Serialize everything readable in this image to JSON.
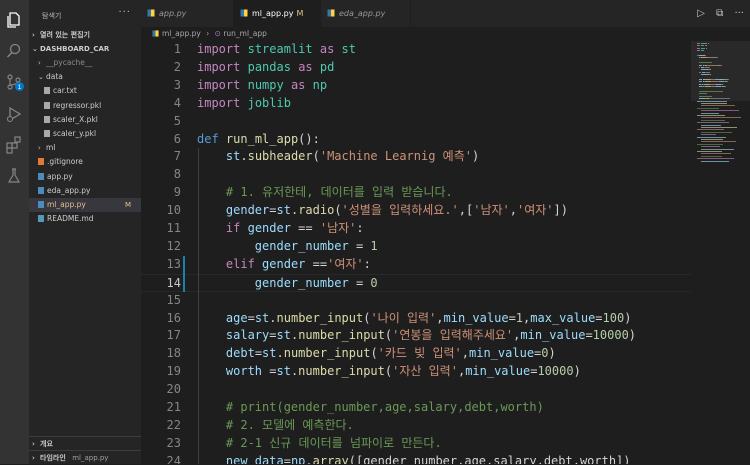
{
  "explorer": {
    "title": "탐색기",
    "more": "···",
    "open_editors": "열려 있는 편집기",
    "project": "DASHBOARD_CAR",
    "tree": [
      {
        "label": "__pycache__",
        "indent": 1,
        "kind": "folder-collapsed",
        "dim": true
      },
      {
        "label": "data",
        "indent": 1,
        "kind": "folder-open"
      },
      {
        "label": "car.txt",
        "indent": 2,
        "kind": "txt"
      },
      {
        "label": "regressor.pkl",
        "indent": 2,
        "kind": "txt"
      },
      {
        "label": "scaler_X.pkl",
        "indent": 2,
        "kind": "txt"
      },
      {
        "label": "scaler_y.pkl",
        "indent": 2,
        "kind": "txt"
      },
      {
        "label": "ml",
        "indent": 1,
        "kind": "folder-collapsed"
      },
      {
        "label": ".gitignore",
        "indent": 1,
        "kind": "git"
      },
      {
        "label": "app.py",
        "indent": 1,
        "kind": "py"
      },
      {
        "label": "eda_app.py",
        "indent": 1,
        "kind": "py"
      },
      {
        "label": "ml_app.py",
        "indent": 1,
        "kind": "py",
        "active": true,
        "badge": "M"
      },
      {
        "label": "README.md",
        "indent": 1,
        "kind": "md"
      }
    ],
    "outline": "개요",
    "timeline": "타임라인",
    "timeline_file": "ml_app.py"
  },
  "tabs": [
    {
      "label": "app.py",
      "active": false
    },
    {
      "label": "ml_app.py",
      "active": true,
      "modified": "M"
    },
    {
      "label": "eda_app.py",
      "active": false
    }
  ],
  "tab_tools": {
    "run": "▷",
    "split": "⧉",
    "more": "···"
  },
  "breadcrumb": {
    "file": "ml_app.py",
    "sep": "›",
    "symbol": "run_ml_app"
  },
  "editor": {
    "current_line": 14,
    "lines": [
      {
        "n": 1,
        "t": [
          [
            "kw",
            "import"
          ],
          [
            "p",
            " "
          ],
          [
            "mod",
            "streamlit"
          ],
          [
            "p",
            " "
          ],
          [
            "kw",
            "as"
          ],
          [
            "p",
            " "
          ],
          [
            "mod",
            "st"
          ]
        ]
      },
      {
        "n": 2,
        "t": [
          [
            "kw",
            "import"
          ],
          [
            "p",
            " "
          ],
          [
            "mod",
            "pandas"
          ],
          [
            "p",
            " "
          ],
          [
            "kw",
            "as"
          ],
          [
            "p",
            " "
          ],
          [
            "mod",
            "pd"
          ]
        ]
      },
      {
        "n": 3,
        "t": [
          [
            "kw",
            "import"
          ],
          [
            "p",
            " "
          ],
          [
            "mod",
            "numpy"
          ],
          [
            "p",
            " "
          ],
          [
            "kw",
            "as"
          ],
          [
            "p",
            " "
          ],
          [
            "mod",
            "np"
          ]
        ]
      },
      {
        "n": 4,
        "t": [
          [
            "kw",
            "import"
          ],
          [
            "p",
            " "
          ],
          [
            "mod",
            "joblib"
          ]
        ]
      },
      {
        "n": 5,
        "t": []
      },
      {
        "n": 6,
        "t": [
          [
            "kw2",
            "def"
          ],
          [
            "p",
            " "
          ],
          [
            "fn",
            "run_ml_app"
          ],
          [
            "p",
            "():"
          ]
        ]
      },
      {
        "n": 7,
        "t": [
          [
            "p",
            "    "
          ],
          [
            "var",
            "st"
          ],
          [
            "p",
            "."
          ],
          [
            "fn",
            "subheader"
          ],
          [
            "p",
            "("
          ],
          [
            "str",
            "'Machine Learnig 예측'"
          ],
          [
            "p",
            ")"
          ]
        ]
      },
      {
        "n": 8,
        "t": []
      },
      {
        "n": 9,
        "t": [
          [
            "p",
            "    "
          ],
          [
            "cmt",
            "# 1. 유저한테, 데이터를 입력 받습니다."
          ]
        ]
      },
      {
        "n": 10,
        "t": [
          [
            "p",
            "    "
          ],
          [
            "var",
            "gender"
          ],
          [
            "p",
            "="
          ],
          [
            "var",
            "st"
          ],
          [
            "p",
            "."
          ],
          [
            "fn",
            "radio"
          ],
          [
            "p",
            "("
          ],
          [
            "str",
            "'성별을 입력하세요.'"
          ],
          [
            "p",
            ",["
          ],
          [
            "str",
            "'남자'"
          ],
          [
            "p",
            ","
          ],
          [
            "str",
            "'여자'"
          ],
          [
            "p",
            "])"
          ]
        ]
      },
      {
        "n": 11,
        "t": [
          [
            "p",
            "    "
          ],
          [
            "kw",
            "if"
          ],
          [
            "p",
            " "
          ],
          [
            "var",
            "gender"
          ],
          [
            "p",
            " == "
          ],
          [
            "str",
            "'남자'"
          ],
          [
            "p",
            ":"
          ]
        ]
      },
      {
        "n": 12,
        "t": [
          [
            "p",
            "        "
          ],
          [
            "var",
            "gender_number"
          ],
          [
            "p",
            " = "
          ],
          [
            "num",
            "1"
          ]
        ]
      },
      {
        "n": 13,
        "t": [
          [
            "p",
            "    "
          ],
          [
            "kw",
            "elif"
          ],
          [
            "p",
            " "
          ],
          [
            "var",
            "gender"
          ],
          [
            "p",
            " =="
          ],
          [
            "str",
            "'여자'"
          ],
          [
            "p",
            ":"
          ]
        ]
      },
      {
        "n": 14,
        "t": [
          [
            "p",
            "        "
          ],
          [
            "var",
            "gender_number"
          ],
          [
            "p",
            " = "
          ],
          [
            "num",
            "0"
          ]
        ]
      },
      {
        "n": 15,
        "t": []
      },
      {
        "n": 16,
        "t": [
          [
            "p",
            "    "
          ],
          [
            "var",
            "age"
          ],
          [
            "p",
            "="
          ],
          [
            "var",
            "st"
          ],
          [
            "p",
            "."
          ],
          [
            "fn",
            "number_input"
          ],
          [
            "p",
            "("
          ],
          [
            "str",
            "'나이 입력'"
          ],
          [
            "p",
            ","
          ],
          [
            "var",
            "min_value"
          ],
          [
            "p",
            "="
          ],
          [
            "num",
            "1"
          ],
          [
            "p",
            ","
          ],
          [
            "var",
            "max_value"
          ],
          [
            "p",
            "="
          ],
          [
            "num",
            "100"
          ],
          [
            "p",
            ")"
          ]
        ]
      },
      {
        "n": 17,
        "t": [
          [
            "p",
            "    "
          ],
          [
            "var",
            "salary"
          ],
          [
            "p",
            "="
          ],
          [
            "var",
            "st"
          ],
          [
            "p",
            "."
          ],
          [
            "fn",
            "number_input"
          ],
          [
            "p",
            "("
          ],
          [
            "str",
            "'연봉을 입력해주세요'"
          ],
          [
            "p",
            ","
          ],
          [
            "var",
            "min_value"
          ],
          [
            "p",
            "="
          ],
          [
            "num",
            "10000"
          ],
          [
            "p",
            ")"
          ]
        ]
      },
      {
        "n": 18,
        "t": [
          [
            "p",
            "    "
          ],
          [
            "var",
            "debt"
          ],
          [
            "p",
            "="
          ],
          [
            "var",
            "st"
          ],
          [
            "p",
            "."
          ],
          [
            "fn",
            "number_input"
          ],
          [
            "p",
            "("
          ],
          [
            "str",
            "'카드 빚 입력'"
          ],
          [
            "p",
            ","
          ],
          [
            "var",
            "min_value"
          ],
          [
            "p",
            "="
          ],
          [
            "num",
            "0"
          ],
          [
            "p",
            ")"
          ]
        ]
      },
      {
        "n": 19,
        "t": [
          [
            "p",
            "    "
          ],
          [
            "var",
            "worth"
          ],
          [
            "p",
            " ="
          ],
          [
            "var",
            "st"
          ],
          [
            "p",
            "."
          ],
          [
            "fn",
            "number_input"
          ],
          [
            "p",
            "("
          ],
          [
            "str",
            "'자산 입력'"
          ],
          [
            "p",
            ","
          ],
          [
            "var",
            "min_value"
          ],
          [
            "p",
            "="
          ],
          [
            "num",
            "10000"
          ],
          [
            "p",
            ")"
          ]
        ]
      },
      {
        "n": 20,
        "t": []
      },
      {
        "n": 21,
        "t": [
          [
            "p",
            "    "
          ],
          [
            "cmt",
            "# print(gender_number,age,salary,debt,worth)"
          ]
        ]
      },
      {
        "n": 22,
        "t": [
          [
            "p",
            "    "
          ],
          [
            "cmt",
            "# 2. 모델에 예측한다."
          ]
        ]
      },
      {
        "n": 23,
        "t": [
          [
            "p",
            "    "
          ],
          [
            "cmt",
            "# 2-1 신규 데이터를 넘파이로 만든다."
          ]
        ]
      },
      {
        "n": 24,
        "t": [
          [
            "p",
            "    "
          ],
          [
            "var",
            "new_data"
          ],
          [
            "p",
            "="
          ],
          [
            "var",
            "np"
          ],
          [
            "p",
            "."
          ],
          [
            "fn",
            "array"
          ],
          [
            "p",
            "([gender_number,age,salary,debt,worth])"
          ]
        ]
      }
    ]
  },
  "colors": {
    "keyword": "#c586c0",
    "def": "#569cd6",
    "function": "#dcdcaa",
    "variable": "#9cdcfe",
    "string": "#ce9178",
    "number": "#b5cea8",
    "comment": "#6a9955",
    "module": "#4ec9b0",
    "modified_badge": "#e2c08d"
  }
}
